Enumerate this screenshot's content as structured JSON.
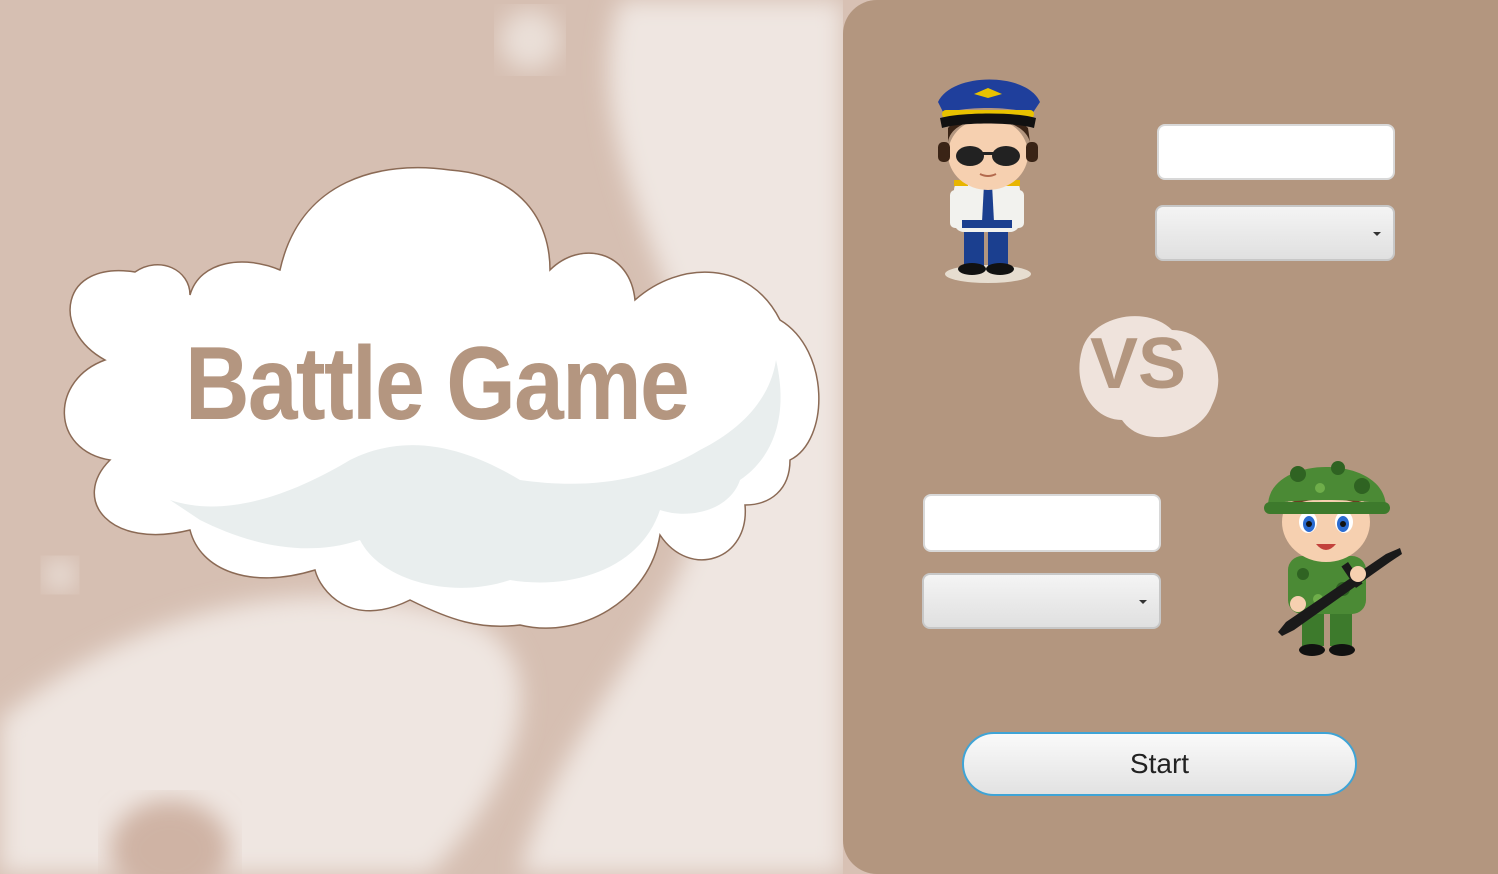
{
  "title": "Battle Game",
  "vs_label": "VS",
  "player1": {
    "name_value": "",
    "class_selected": ""
  },
  "player2": {
    "name_value": "",
    "class_selected": ""
  },
  "start_label": "Start",
  "icons": [
    "pilot-character-icon",
    "soldier-character-icon",
    "vs-badge-icon",
    "chevron-down-icon"
  ],
  "colors": {
    "background": "#d8c1b4",
    "panel": "#b3967f",
    "title_text": "#b49680",
    "start_border": "#3fa4d6"
  }
}
